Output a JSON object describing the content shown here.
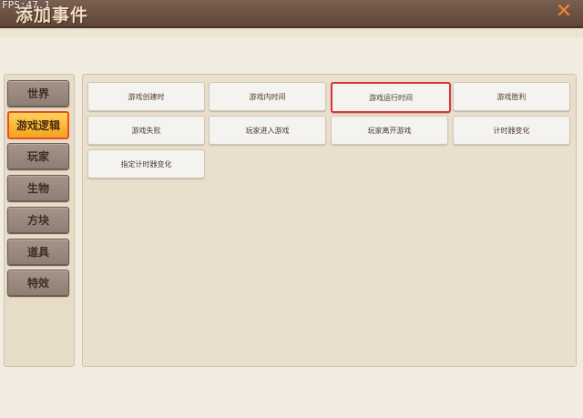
{
  "window": {
    "fps_text": "FPS:47.1",
    "title": "添加事件",
    "close_symbol": "✕"
  },
  "sidebar": {
    "items": [
      {
        "label": "世界",
        "active": false
      },
      {
        "label": "游戏逻辑",
        "active": true
      },
      {
        "label": "玩家",
        "active": false
      },
      {
        "label": "生物",
        "active": false
      },
      {
        "label": "方块",
        "active": false
      },
      {
        "label": "道具",
        "active": false
      },
      {
        "label": "特效",
        "active": false
      }
    ]
  },
  "events": {
    "items": [
      {
        "label": "游戏创建时",
        "selected": false
      },
      {
        "label": "游戏内时间",
        "selected": false
      },
      {
        "label": "游戏运行时间",
        "selected": true
      },
      {
        "label": "游戏胜利",
        "selected": false
      },
      {
        "label": "游戏失败",
        "selected": false
      },
      {
        "label": "玩家进入游戏",
        "selected": false
      },
      {
        "label": "玩家离开游戏",
        "selected": false
      },
      {
        "label": "计时器变化",
        "selected": false
      },
      {
        "label": "指定计时器变化",
        "selected": false
      }
    ]
  },
  "colors": {
    "titlebar": "#6b5143",
    "accent_orange": "#f6822a",
    "selected_border": "#d9343a",
    "active_tab": "#f4a21f"
  }
}
